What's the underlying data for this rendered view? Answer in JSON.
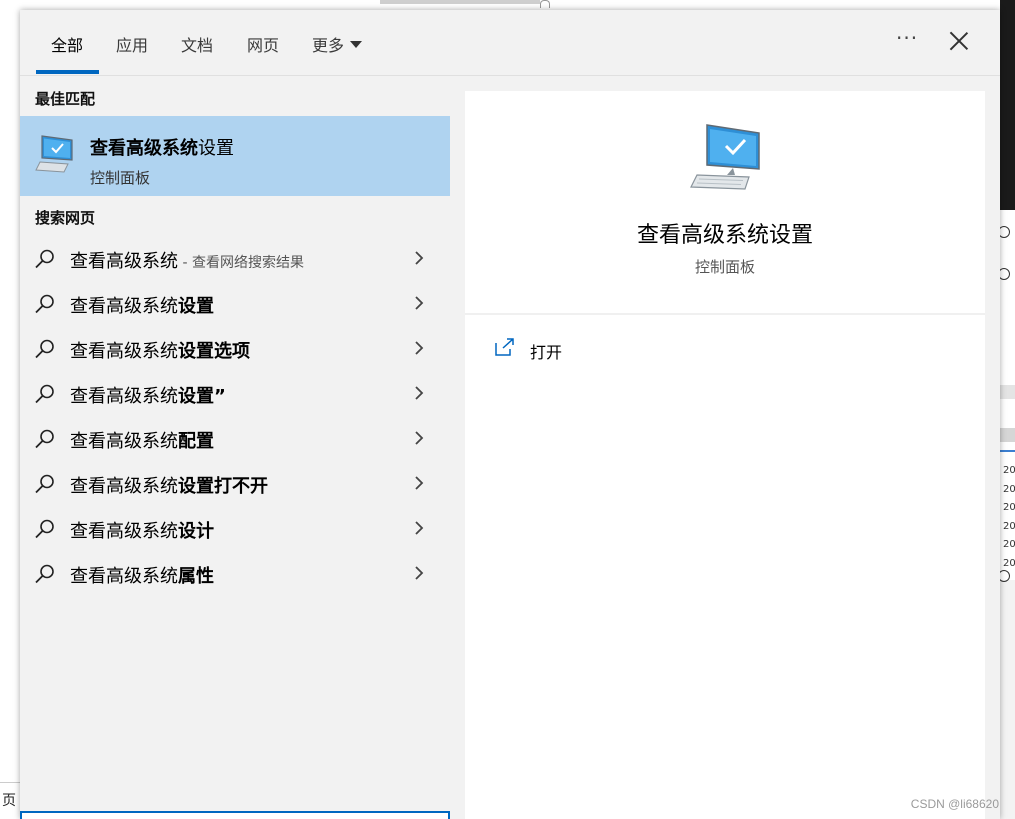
{
  "tabs": [
    {
      "label": "全部",
      "active": true
    },
    {
      "label": "应用",
      "active": false
    },
    {
      "label": "文档",
      "active": false
    },
    {
      "label": "网页",
      "active": false
    },
    {
      "label": "更多",
      "active": false
    }
  ],
  "toolbar": {
    "more_options": "···"
  },
  "best_match": {
    "section_title": "最佳匹配",
    "title_bold": "查看高级系统",
    "title_rest": "设置",
    "subtitle": "控制面板",
    "icon": "computer-monitor-icon"
  },
  "web_search": {
    "section_title": "搜索网页",
    "items": [
      {
        "normal": "查看高级系统",
        "bold": "",
        "hint": " - 查看网络搜索结果"
      },
      {
        "normal": "查看高级系统",
        "bold": "设置",
        "hint": ""
      },
      {
        "normal": "查看高级系统",
        "bold": "设置选项",
        "hint": ""
      },
      {
        "normal": "查看高级系统",
        "bold": "设置”",
        "hint": ""
      },
      {
        "normal": "查看高级系统",
        "bold": "配置",
        "hint": ""
      },
      {
        "normal": "查看高级系统",
        "bold": "设置打不开",
        "hint": ""
      },
      {
        "normal": "查看高级系统",
        "bold": "设计",
        "hint": ""
      },
      {
        "normal": "查看高级系统",
        "bold": "属性",
        "hint": ""
      }
    ]
  },
  "detail": {
    "title": "查看高级系统设置",
    "subtitle": "控制面板",
    "action_open": "打开",
    "icon": "computer-monitor-icon"
  },
  "background": {
    "page_label": "页",
    "side_numbers": [
      "20",
      "20",
      "20",
      "20",
      "20",
      "20"
    ]
  },
  "watermark": "CSDN @li68620",
  "colors": {
    "accent": "#0067c0",
    "selected_bg": "#afd3f0"
  }
}
